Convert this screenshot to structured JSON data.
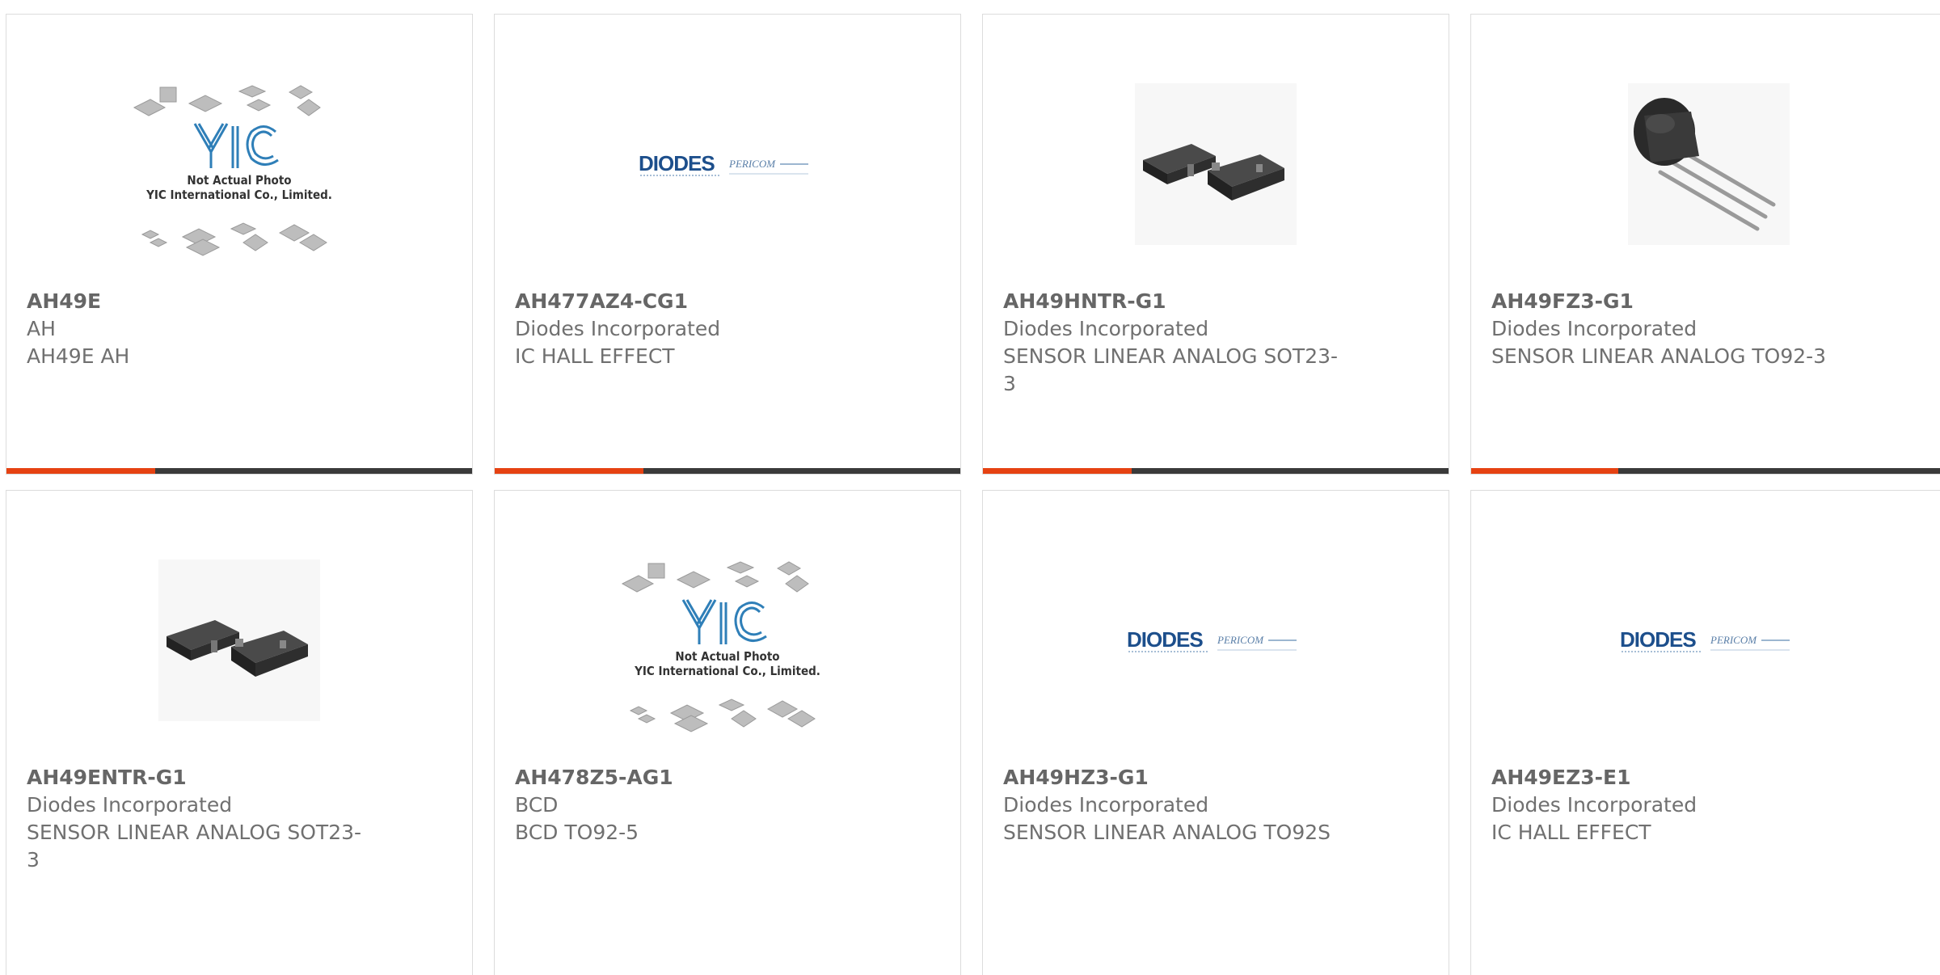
{
  "products": [
    {
      "part_number": "AH49E",
      "manufacturer": "AH",
      "description": "AH49E AH",
      "image": {
        "type": "yic-placeholder",
        "line1": "Not Actual Photo",
        "line2": "YIC International Co., Limited."
      }
    },
    {
      "part_number": "AH477AZ4-CG1",
      "manufacturer": "Diodes Incorporated",
      "description": "IC HALL EFFECT",
      "image": {
        "type": "diodes-logo",
        "logo_text": "DIODES",
        "sub_text": "PERICOM"
      }
    },
    {
      "part_number": "AH49HNTR-G1",
      "manufacturer": "Diodes Incorporated",
      "description": "SENSOR LINEAR ANALOG SOT23-3",
      "image": {
        "type": "sot23-photo"
      }
    },
    {
      "part_number": "AH49FZ3-G1",
      "manufacturer": "Diodes Incorporated",
      "description": "SENSOR LINEAR ANALOG TO92-3",
      "image": {
        "type": "to92-photo"
      }
    },
    {
      "part_number": "AH49ENTR-G1",
      "manufacturer": "Diodes Incorporated",
      "description": "SENSOR LINEAR ANALOG SOT23-3",
      "image": {
        "type": "sot23-photo"
      }
    },
    {
      "part_number": "AH478Z5-AG1",
      "manufacturer": "BCD",
      "description": "BCD TO92-5",
      "image": {
        "type": "yic-placeholder",
        "line1": "Not Actual Photo",
        "line2": "YIC International Co., Limited."
      }
    },
    {
      "part_number": "AH49HZ3-G1",
      "manufacturer": "Diodes Incorporated",
      "description": "SENSOR LINEAR ANALOG TO92S",
      "image": {
        "type": "diodes-logo",
        "logo_text": "DIODES",
        "sub_text": "PERICOM"
      }
    },
    {
      "part_number": "AH49EZ3-E1",
      "manufacturer": "Diodes Incorporated",
      "description": "IC HALL EFFECT",
      "image": {
        "type": "diodes-logo",
        "logo_text": "DIODES",
        "sub_text": "PERICOM"
      }
    }
  ],
  "colors": {
    "accent": "#e64212",
    "bar": "#3a3a3a",
    "text": "#707070",
    "border": "#dcdcdc"
  }
}
